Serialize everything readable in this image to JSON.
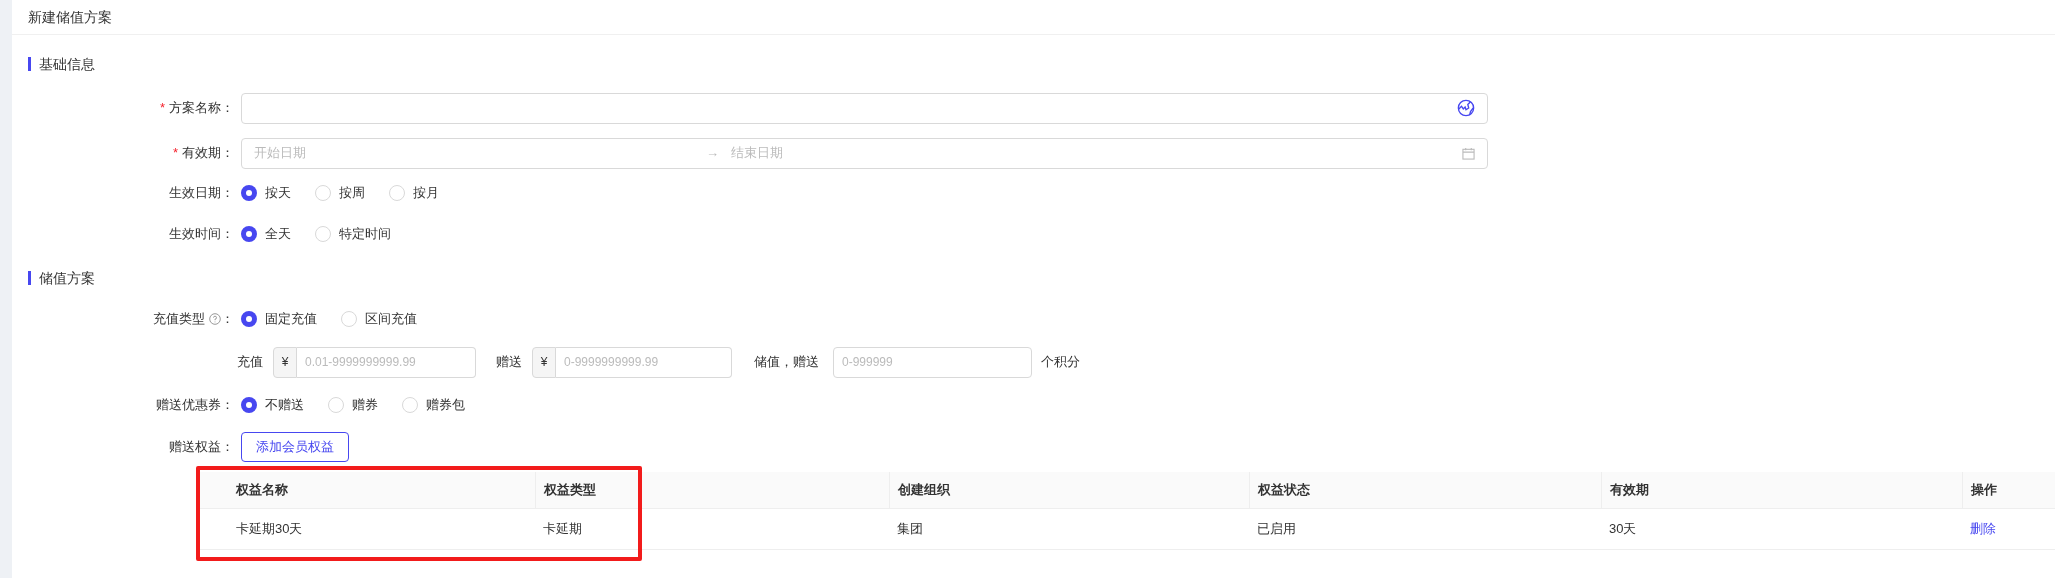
{
  "title": "新建储值方案",
  "basic_info": {
    "heading": "基础信息",
    "plan_name": {
      "required_mark": "*",
      "label": "方案名称："
    },
    "validity": {
      "required_mark": "*",
      "label": "有效期：",
      "start_placeholder": "开始日期",
      "separator": "→",
      "end_placeholder": "结束日期"
    },
    "effective_date": {
      "label": "生效日期：",
      "options": [
        {
          "label": "按天",
          "selected": true
        },
        {
          "label": "按周",
          "selected": false
        },
        {
          "label": "按月",
          "selected": false
        }
      ]
    },
    "effective_time": {
      "label": "生效时间：",
      "options": [
        {
          "label": "全天",
          "selected": true
        },
        {
          "label": "特定时间",
          "selected": false
        }
      ]
    }
  },
  "stored_value": {
    "heading": "储值方案",
    "recharge_type": {
      "label": "充值类型",
      "suffix": "：",
      "options": [
        {
          "label": "固定充值",
          "selected": true
        },
        {
          "label": "区间充值",
          "selected": false
        }
      ]
    },
    "amounts": {
      "recharge_label": "充值",
      "recharge_currency": "¥",
      "recharge_placeholder": "0.01-9999999999.99",
      "bonus_label": "赠送",
      "bonus_currency": "¥",
      "bonus_placeholder": "0-9999999999.99",
      "points_label": "储值，赠送",
      "points_placeholder": "0-999999",
      "points_unit": "个积分"
    },
    "coupon": {
      "label": "赠送优惠券：",
      "options": [
        {
          "label": "不赠送",
          "selected": true
        },
        {
          "label": "赠券",
          "selected": false
        },
        {
          "label": "赠券包",
          "selected": false
        }
      ]
    },
    "benefits": {
      "label": "赠送权益：",
      "add_button": "添加会员权益"
    },
    "table": {
      "columns": [
        "权益名称",
        "权益类型",
        "创建组织",
        "权益状态",
        "有效期",
        "操作"
      ],
      "rows": [
        {
          "cells": [
            "卡延期30天",
            "卡延期",
            "集团",
            "已启用",
            "30天"
          ],
          "action": "删除"
        }
      ]
    }
  }
}
